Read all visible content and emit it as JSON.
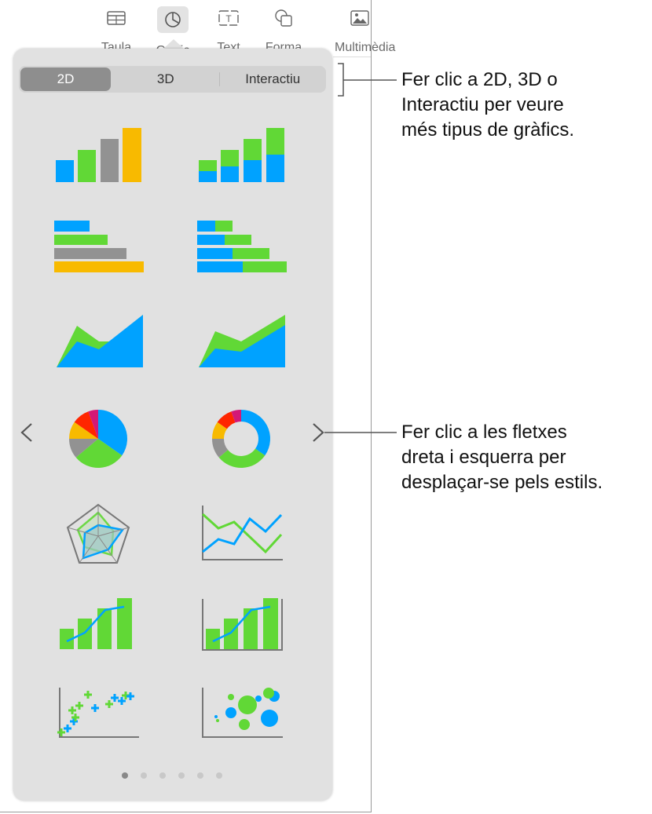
{
  "toolbar": {
    "items": [
      {
        "label": "Taula",
        "icon": "table-icon"
      },
      {
        "label": "Gràfic",
        "icon": "chart-icon",
        "selected": true
      },
      {
        "label": "Text",
        "icon": "text-box-icon"
      },
      {
        "label": "Forma",
        "icon": "shape-icon"
      },
      {
        "label": "Multimèdia",
        "icon": "media-icon"
      }
    ]
  },
  "popover": {
    "tabs": [
      {
        "label": "2D",
        "selected": true
      },
      {
        "label": "3D"
      },
      {
        "label": "Interactiu"
      }
    ],
    "charts": [
      "column",
      "stacked-column",
      "bar",
      "stacked-bar",
      "area",
      "stacked-area",
      "pie",
      "donut",
      "radar",
      "line",
      "mixed",
      "two-axis",
      "scatter",
      "bubble"
    ],
    "page_dots": {
      "count": 6,
      "current": 1
    },
    "nav": {
      "prev": "chevron-left-icon",
      "next": "chevron-right-icon"
    }
  },
  "callouts": [
    {
      "lines": [
        "Fer clic a 2D, 3D o",
        "Interactiu per veure",
        "més tipus de gràfics."
      ]
    },
    {
      "lines": [
        "Fer clic a les fletxes",
        "dreta i esquerra per",
        "desplaçar-se pels estils."
      ]
    }
  ],
  "colors": {
    "blue": "#00a2ff",
    "green": "#61d836",
    "gray": "#929292",
    "yellow": "#f8ba00",
    "red": "#ff2600",
    "magenta": "#d31876",
    "selected_tab": "#8e8e8e",
    "popover": "#e1e1e1"
  }
}
